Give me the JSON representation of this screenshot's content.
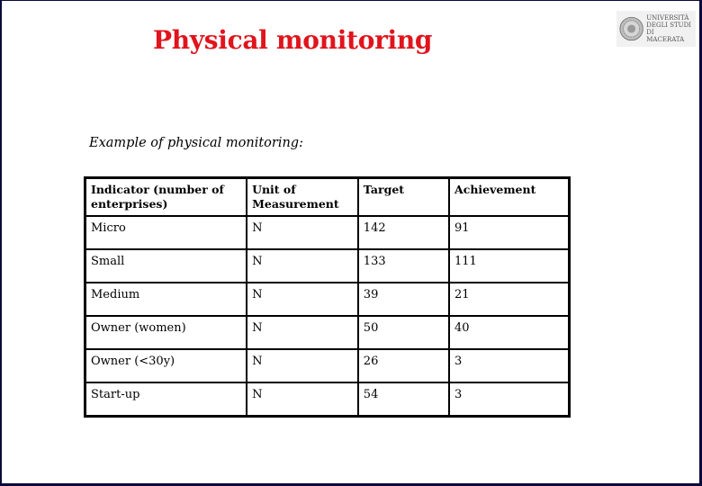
{
  "slide": {
    "title": "Physical monitoring",
    "title_color": "#e0141c",
    "subtitle": "Example of physical monitoring:",
    "logo": {
      "icon": "university-seal-icon",
      "text": "UNIVERSITÀ\nDEGLI STUDI DI\nMACERATA"
    }
  },
  "table": {
    "headers": [
      "Indicator (number of enterprises)",
      "Unit of Measurement",
      "Target",
      "Achievement"
    ],
    "rows": [
      [
        "Micro",
        "N",
        "142",
        "91"
      ],
      [
        "Small",
        "N",
        "133",
        "111"
      ],
      [
        "Medium",
        "N",
        "39",
        "21"
      ],
      [
        "Owner (women)",
        "N",
        "50",
        "40"
      ],
      [
        "Owner (<30y)",
        "N",
        "26",
        "3"
      ],
      [
        "Start-up",
        "N",
        "54",
        "3"
      ]
    ]
  }
}
